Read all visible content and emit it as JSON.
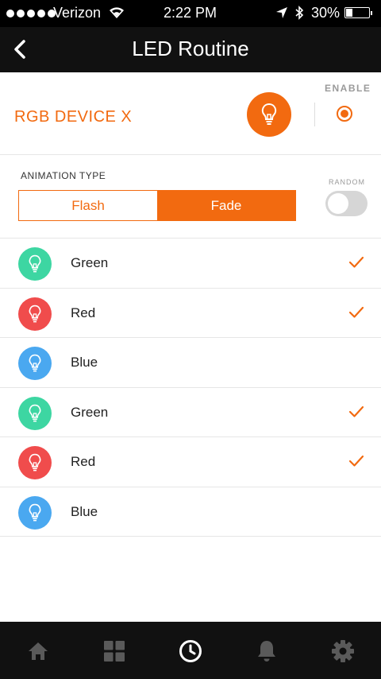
{
  "status": {
    "carrier": "Verizon",
    "time": "2:22 PM",
    "battery": "30%",
    "battery_level": 0.3
  },
  "nav": {
    "title": "LED Routine"
  },
  "device": {
    "name": "RGB DEVICE X",
    "enable_label": "ENABLE",
    "enabled": true
  },
  "animation": {
    "label": "ANIMATION TYPE",
    "options": [
      "Flash",
      "Fade"
    ],
    "selected": "Fade",
    "random_label": "RANDOM",
    "random": false
  },
  "colors": {
    "accent": "#f26a10",
    "green": "#3dd6a2",
    "red": "#f04c4c",
    "blue": "#4aa8f0"
  },
  "items": [
    {
      "label": "Green",
      "color": "#3dd6a2",
      "checked": true
    },
    {
      "label": "Red",
      "color": "#f04c4c",
      "checked": true
    },
    {
      "label": "Blue",
      "color": "#4aa8f0",
      "checked": false
    },
    {
      "label": "Green",
      "color": "#3dd6a2",
      "checked": true
    },
    {
      "label": "Red",
      "color": "#f04c4c",
      "checked": true
    },
    {
      "label": "Blue",
      "color": "#4aa8f0",
      "checked": false
    }
  ],
  "tabs": [
    "home-icon",
    "grid-icon",
    "clock-icon",
    "bell-icon",
    "gear-icon"
  ],
  "active_tab": "clock-icon"
}
